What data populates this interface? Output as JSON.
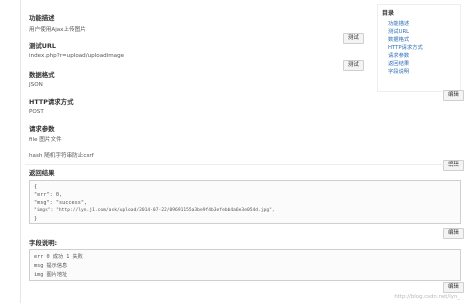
{
  "sections": {
    "desc": {
      "label": "功能描述",
      "value": "用户使用Ajax上传图片"
    },
    "url": {
      "label": "测试URL",
      "value": "index.php?r=upload/uploadimage"
    },
    "format": {
      "label": "数据格式",
      "value": "JSON"
    },
    "method": {
      "label": "HTTP请求方式",
      "value": "POST"
    },
    "params": {
      "label": "请求参数",
      "value1": "file 图片文件",
      "value2": "hash 随机字符串防止csrf"
    },
    "result": {
      "label": "返回结果",
      "lines": [
        "{",
        "  \"err\": 0,",
        "  \"msg\": \"success\",",
        "  \"imgs\": \"http://lyn.j1.com/ask/upload/2014-07-22/09691155a3be9f4b3efebb4a6e3e054d.jpg\",",
        "}"
      ]
    },
    "fields": {
      "label": "字段说明:",
      "lines": [
        "err   0 成功 1 失败",
        "msg   提示信息",
        "img   图片地址"
      ]
    }
  },
  "buttons": {
    "test1": "测试",
    "test2": "测试",
    "edit": "编辑"
  },
  "toc": {
    "title": "目录",
    "items": [
      "功能描述",
      "测试URL",
      "数据格式",
      "HTTP请求方式",
      "请求参数",
      "返回结果",
      "字段说明"
    ]
  },
  "watermark": "http://blog.csdn.net/lyn_"
}
